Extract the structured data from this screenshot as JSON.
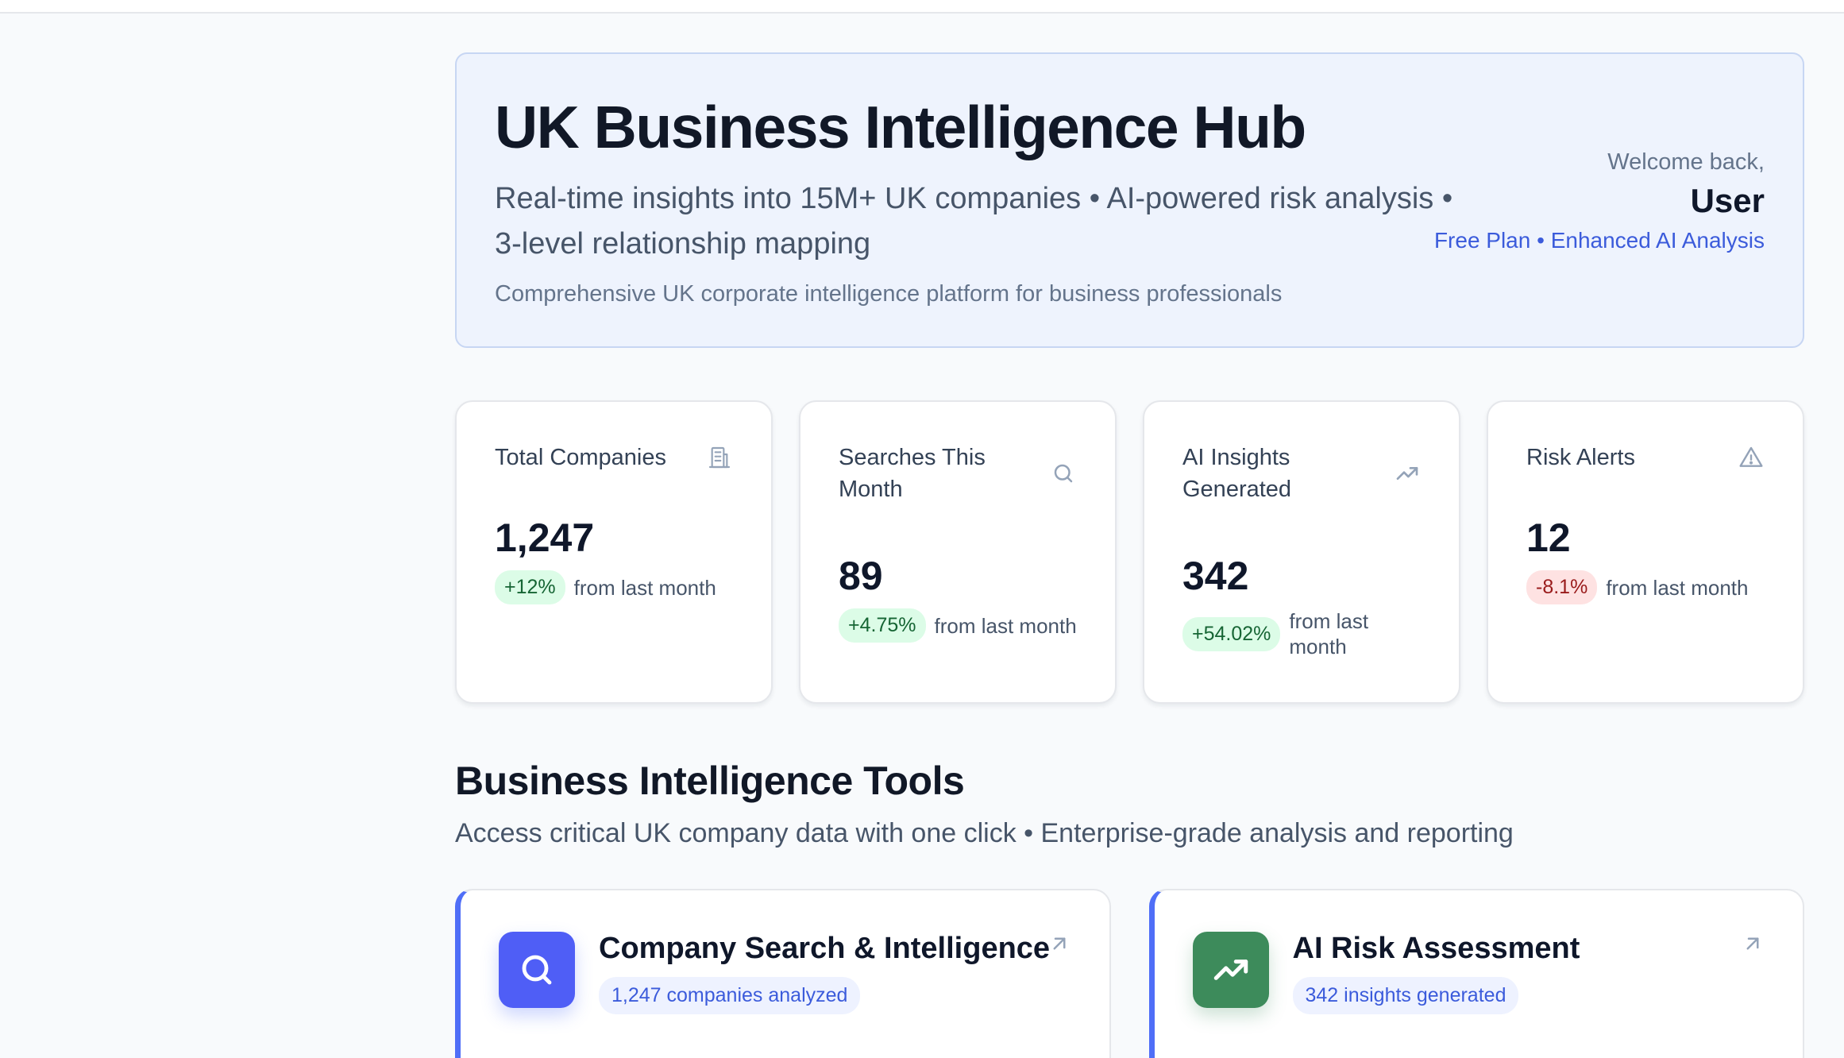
{
  "hero": {
    "title": "UK Business Intelligence Hub",
    "subtitle": "Real-time insights into 15M+ UK companies • AI-powered risk analysis • 3-level relationship mapping",
    "description": "Comprehensive UK corporate intelligence platform for business professionals",
    "welcome_label": "Welcome back,",
    "user_name": "User",
    "plan": "Free Plan • Enhanced AI Analysis"
  },
  "stats": [
    {
      "label": "Total Companies",
      "icon": "building-icon",
      "value": "1,247",
      "change": "+12%",
      "change_type": "positive",
      "suffix": "from last month"
    },
    {
      "label": "Searches This Month",
      "icon": "search-icon",
      "value": "89",
      "change": "+4.75%",
      "change_type": "positive",
      "suffix": "from last month"
    },
    {
      "label": "AI Insights Generated",
      "icon": "trending-up-icon",
      "value": "342",
      "change": "+54.02%",
      "change_type": "positive",
      "suffix": "from last month"
    },
    {
      "label": "Risk Alerts",
      "icon": "alert-triangle-icon",
      "value": "12",
      "change": "-8.1%",
      "change_type": "negative",
      "suffix": "from last month"
    }
  ],
  "tools_section": {
    "title": "Business Intelligence Tools",
    "subtitle": "Access critical UK company data with one click • Enterprise-grade analysis and reporting"
  },
  "tools": [
    {
      "title": "Company Search & Intelligence",
      "badge": "1,247 companies analyzed",
      "icon": "search-icon",
      "color": "#4f5ef6"
    },
    {
      "title": "AI Risk Assessment",
      "badge": "342 insights generated",
      "icon": "trending-up-icon",
      "color": "#3d8b5b"
    }
  ],
  "colors": {
    "accent": "#4f6ef7",
    "positive": "#166534",
    "negative": "#991b1b"
  }
}
